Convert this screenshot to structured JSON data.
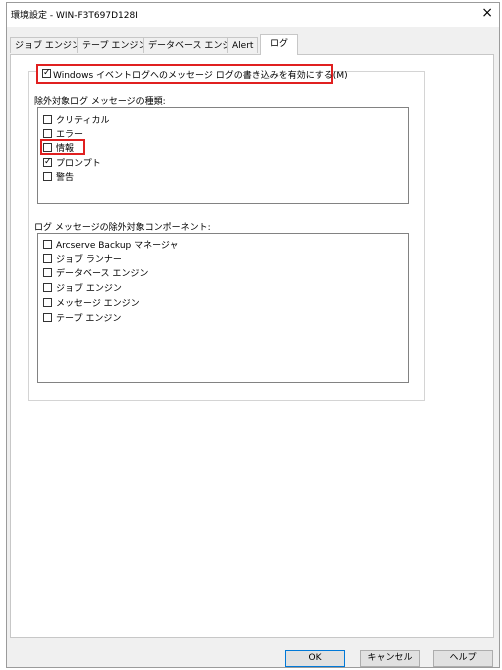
{
  "window": {
    "title": "環境設定 - WIN-F3T697D128I",
    "close_glyph": "×"
  },
  "tabs": [
    {
      "label": "ジョブ エンジン"
    },
    {
      "label": "テープ エンジン"
    },
    {
      "label": "データベース エンジン"
    },
    {
      "label": "Alert"
    },
    {
      "label": "ログ"
    }
  ],
  "enable_log": {
    "label": "Windows イベントログへのメッセージ ログの書き込みを有効にする(M)",
    "checked": true
  },
  "types": {
    "heading": "除外対象ログ メッセージの種類:",
    "items": [
      {
        "label": "クリティカル",
        "checked": false
      },
      {
        "label": "エラー",
        "checked": false
      },
      {
        "label": "情報",
        "checked": false
      },
      {
        "label": "プロンプト",
        "checked": true
      },
      {
        "label": "警告",
        "checked": false
      }
    ]
  },
  "components": {
    "heading": "ログ メッセージの除外対象コンポーネント:",
    "items": [
      {
        "label": "Arcserve Backup マネージャ",
        "checked": false
      },
      {
        "label": "ジョブ ランナー",
        "checked": false
      },
      {
        "label": "データベース エンジン",
        "checked": false
      },
      {
        "label": "ジョブ エンジン",
        "checked": false
      },
      {
        "label": "メッセージ エンジン",
        "checked": false
      },
      {
        "label": "テープ エンジン",
        "checked": false
      }
    ]
  },
  "buttons": {
    "ok": "OK",
    "cancel": "キャンセル",
    "help": "ヘルプ"
  },
  "colors": {
    "highlight": "#e02020",
    "default_button_border": "#0078d7"
  }
}
